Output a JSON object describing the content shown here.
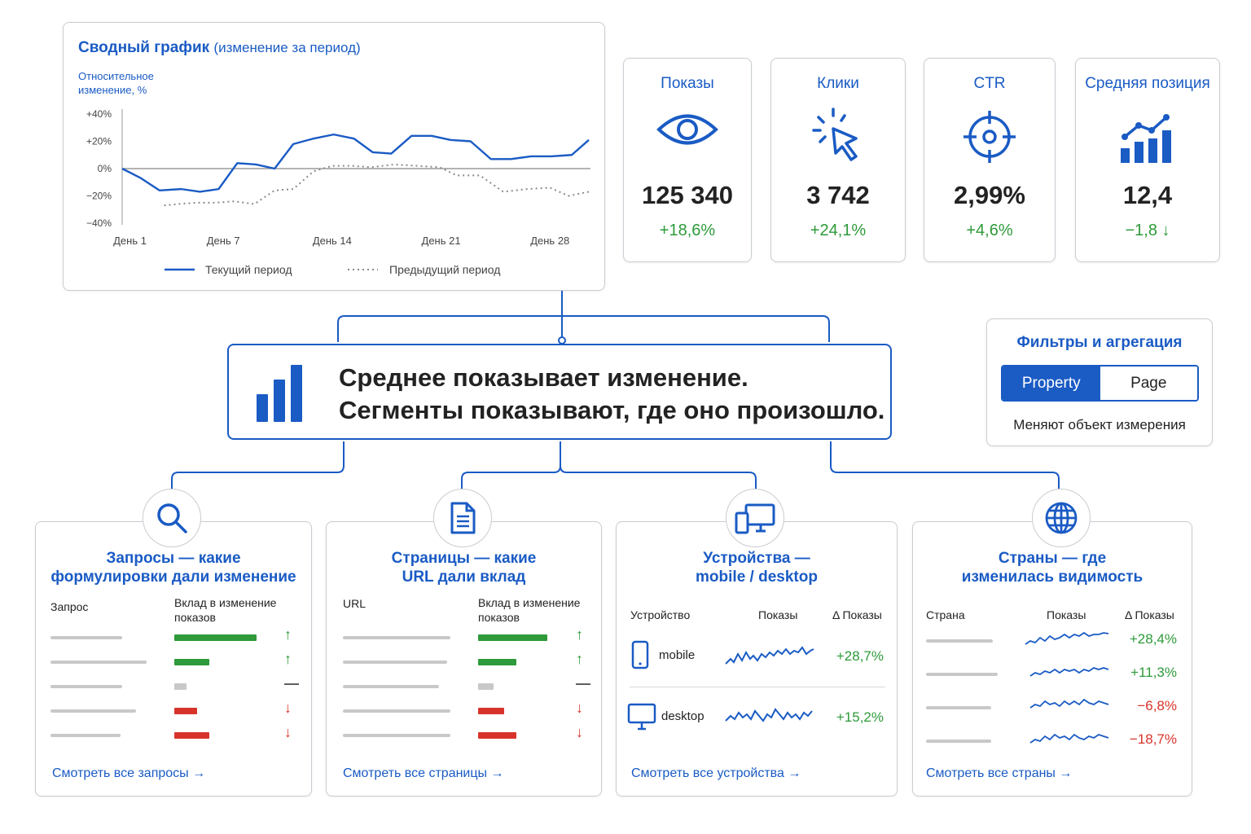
{
  "summary_chart": {
    "title": "Сводный график",
    "title_suffix": "(изменение за период)",
    "ylabel": "Относительное изменение, %",
    "legend_current": "Текущий период",
    "legend_previous": "Предыдущий период"
  },
  "chart_data": {
    "type": "line",
    "title": "Сводный график (изменение за период)",
    "ylabel": "Относительное изменение, %",
    "xlabel": "",
    "ylim": [
      -40,
      40
    ],
    "y_ticks": [
      "+40%",
      "+20%",
      "0%",
      "−20%",
      "−40%"
    ],
    "x_tick_labels": [
      "День 1",
      "День 7",
      "День 14",
      "День 21",
      "День 28"
    ],
    "x_tick_days": [
      1,
      7,
      14,
      21,
      28
    ],
    "grid": false,
    "legend_placement": "bottom",
    "series": [
      {
        "name": "Текущий период",
        "style": "solid",
        "color": "#1a5bc4",
        "x": [
          0,
          1.2,
          2.4,
          3.8,
          5.0,
          6.2,
          7.4,
          8.6,
          9.8,
          11.0,
          12.3,
          13.6,
          14.9,
          16.1,
          17.3,
          18.6,
          19.9,
          21.1,
          22.4,
          23.7,
          25.0,
          26.3,
          27.6,
          28.9,
          30.0
        ],
        "y": [
          0,
          -7,
          -16,
          -15,
          -17,
          -15,
          4,
          3,
          0,
          18,
          22,
          25,
          22,
          12,
          11,
          24,
          24,
          21,
          20,
          7,
          7,
          9,
          9,
          10,
          21
        ]
      },
      {
        "name": "Предыдущий период",
        "style": "dotted",
        "color": "#8a8a8a",
        "x": [
          2.7,
          3.6,
          4.8,
          6.0,
          7.2,
          8.5,
          9.8,
          11.0,
          12.3,
          13.5,
          14.8,
          16.0,
          17.5,
          19.0,
          20.4,
          21.5,
          23.0,
          24.5,
          26.0,
          27.5,
          28.7,
          30.0
        ],
        "y": [
          -27,
          -26,
          -25,
          -25,
          -24,
          -26,
          -16,
          -15,
          -2,
          2,
          2,
          1,
          3,
          2,
          1,
          -5,
          -5,
          -17,
          -15,
          -14,
          -20,
          -17
        ]
      }
    ]
  },
  "metrics": [
    {
      "title": "Показы",
      "value": "125 340",
      "delta": "+18,6%",
      "icon": "eye-icon"
    },
    {
      "title": "Клики",
      "value": "3 742",
      "delta": "+24,1%",
      "icon": "cursor-click-icon"
    },
    {
      "title": "CTR",
      "value": "2,99%",
      "delta": "+4,6%",
      "icon": "target-icon"
    },
    {
      "title": "Средняя позиция",
      "value": "12,4",
      "delta": "−1,8",
      "delta_arrow": "↓",
      "icon": "bar-chart-trend-icon"
    }
  ],
  "center": {
    "line1": "Среднее показывает изменение.",
    "line2": "Сегменты показывают, где оно произошло.",
    "icon": "bar-chart-icon"
  },
  "filters": {
    "title": "Фильтры и агрегация",
    "option_active": "Property",
    "option_inactive": "Page",
    "note": "Меняют объект измерения"
  },
  "colors": {
    "accent": "#1a5bc4",
    "positive": "#2e9a3a",
    "negative": "#d8332b",
    "neutral": "#c8c8c8"
  },
  "segments": {
    "queries": {
      "title_l1": "Запросы — какие",
      "title_l2": "формулировки дали изменение",
      "col1": "Запрос",
      "col2": "Вклад в изменение показов",
      "link": "Смотреть все запросы",
      "link_arrow": "→",
      "icon": "search-icon",
      "rows": [
        {
          "contribution": 1.0,
          "direction": "up",
          "arrow": "↑"
        },
        {
          "contribution": 0.43,
          "direction": "up",
          "arrow": "↑"
        },
        {
          "contribution": 0.15,
          "direction": "neutral",
          "arrow": "—"
        },
        {
          "contribution": -0.28,
          "direction": "down",
          "arrow": "↓"
        },
        {
          "contribution": -0.43,
          "direction": "down",
          "arrow": "↓"
        }
      ]
    },
    "pages": {
      "title_l1": "Страницы — какие",
      "title_l2": "URL дали вклад",
      "col1": "URL",
      "col2": "Вклад в изменение показов",
      "link": "Смотреть все страницы",
      "link_arrow": "→",
      "icon": "document-icon",
      "rows": [
        {
          "contribution": 1.0,
          "direction": "up",
          "arrow": "↑"
        },
        {
          "contribution": 0.55,
          "direction": "up",
          "arrow": "↑"
        },
        {
          "contribution": 0.22,
          "direction": "neutral",
          "arrow": "—"
        },
        {
          "contribution": -0.38,
          "direction": "down",
          "arrow": "↓"
        },
        {
          "contribution": -0.55,
          "direction": "down",
          "arrow": "↓"
        }
      ]
    },
    "devices": {
      "title_l1": "Устройства —",
      "title_l2": "mobile / desktop",
      "col1": "Устройство",
      "col2": "Показы",
      "col3": "Δ Показы",
      "link": "Смотреть все устройства",
      "link_arrow": "→",
      "icon": "devices-icon",
      "rows": [
        {
          "name": "mobile",
          "delta": "+28,7%",
          "icon": "phone-icon"
        },
        {
          "name": "desktop",
          "delta": "+15,2%",
          "icon": "monitor-icon"
        }
      ]
    },
    "countries": {
      "title_l1": "Страны — где",
      "title_l2": "изменилась видимость",
      "col1": "Страна",
      "col2": "Показы",
      "col3": "Δ Показы",
      "link": "Смотреть все страны",
      "link_arrow": "→",
      "icon": "globe-icon",
      "rows": [
        {
          "delta": "+28,4%",
          "direction": "up"
        },
        {
          "delta": "+11,3%",
          "direction": "up"
        },
        {
          "delta": "−6,8%",
          "direction": "down"
        },
        {
          "delta": "−18,7%",
          "direction": "down"
        }
      ]
    }
  }
}
